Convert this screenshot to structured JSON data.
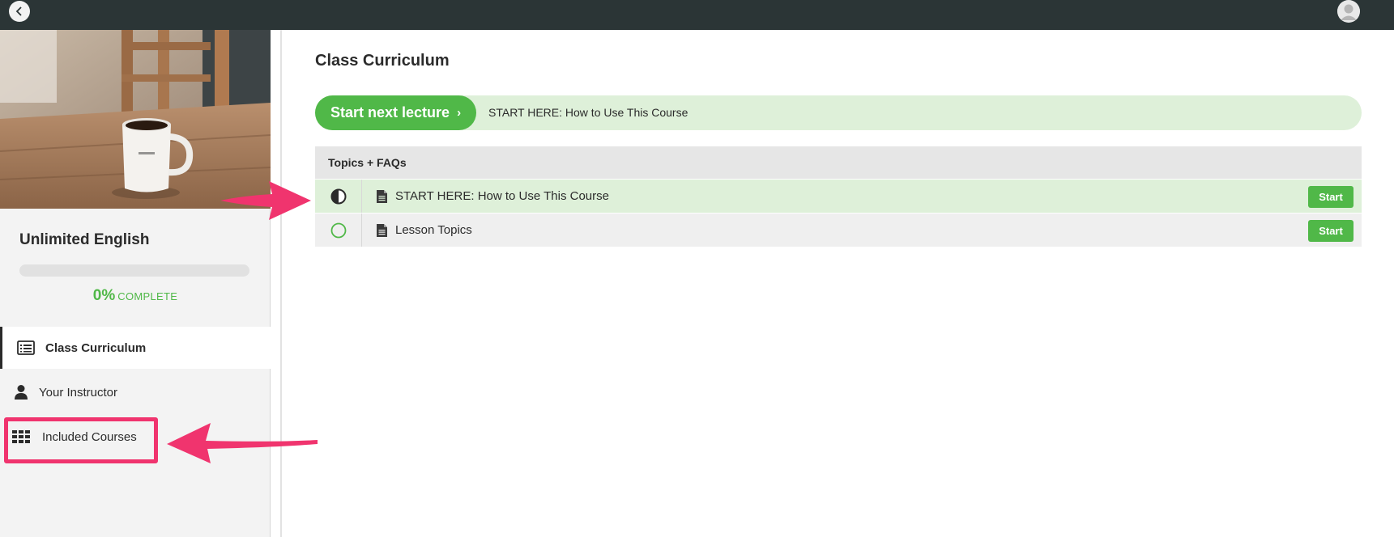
{
  "colors": {
    "topbar": "#2b3536",
    "accent_green": "#50b848",
    "light_green": "#def0d9",
    "annotation_pink": "#f0346e"
  },
  "topbar": {
    "back_icon": "chevron-left-icon",
    "avatar_icon": "user-avatar-icon"
  },
  "sidebar": {
    "course_title": "Unlimited English",
    "progress_value": 0,
    "progress_percent": "0%",
    "progress_word": "COMPLETE",
    "nav": [
      {
        "label": "Class Curriculum",
        "icon": "list-icon",
        "active": true
      },
      {
        "label": "Your Instructor",
        "icon": "person-icon",
        "active": false
      },
      {
        "label": "Included Courses",
        "icon": "grid-icon",
        "active": false
      }
    ]
  },
  "main": {
    "title": "Class Curriculum",
    "next_lecture": {
      "button_label": "Start next lecture",
      "lecture_title": "START HERE: How to Use This Course"
    },
    "sections": [
      {
        "title": "Topics + FAQs",
        "lectures": [
          {
            "title": "START HERE: How to Use This Course",
            "status": "in-progress",
            "action": "Start"
          },
          {
            "title": "Lesson Topics",
            "status": "not-started",
            "action": "Start"
          }
        ]
      }
    ]
  }
}
